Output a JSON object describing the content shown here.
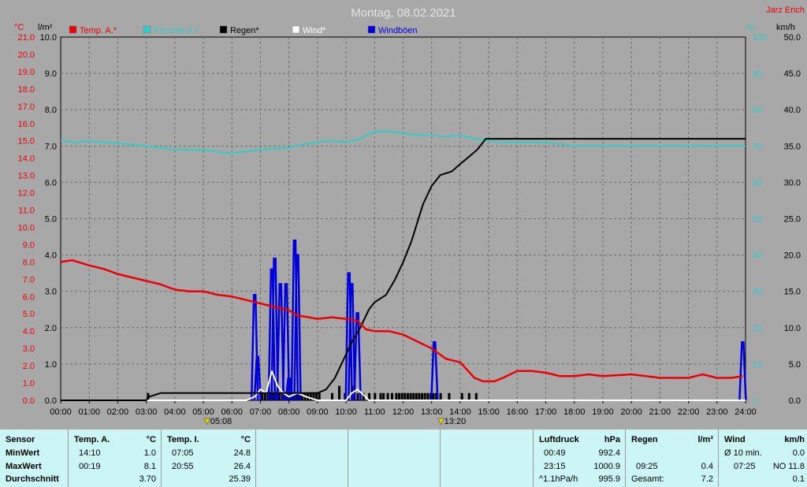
{
  "chart_data": {
    "type": "line",
    "title": "Montag, 08.02.2021",
    "station": "Jarz Erich",
    "colors": {
      "temp": "#ee0000",
      "humidity": "#33cccc",
      "rain": "#000000",
      "wind": "#ffffff",
      "gust": "#0000dd"
    },
    "legend": [
      {
        "label": "Temp. A.*",
        "color": "#ee0000"
      },
      {
        "label": "Feuchte A.*",
        "color": "#33cccc"
      },
      {
        "label": "Regen*",
        "color": "#000000"
      },
      {
        "label": "Wind*",
        "color": "#ffffff"
      },
      {
        "label": "Windböen",
        "color": "#0000dd"
      }
    ],
    "axes": {
      "temp": {
        "unit": "°C",
        "min": 0,
        "max": 21,
        "ticks": [
          "0.0",
          "1.0",
          "2.0",
          "3.0",
          "4.0",
          "5.0",
          "6.0",
          "7.0",
          "8.0",
          "9.0",
          "10.0",
          "11.0",
          "12.0",
          "13.0",
          "14.0",
          "15.0",
          "16.0",
          "17.0",
          "18.0",
          "19.0",
          "20.0",
          "21.0"
        ]
      },
      "rain": {
        "unit": "l/m²",
        "min": 0,
        "max": 10,
        "ticks": [
          "0.0",
          "1.0",
          "2.0",
          "3.0",
          "4.0",
          "5.0",
          "6.0",
          "7.0",
          "8.0",
          "9.0",
          "10.0"
        ]
      },
      "humidity": {
        "unit": "%",
        "min": 0,
        "max": 100,
        "ticks": [
          "0",
          "10",
          "20",
          "30",
          "40",
          "50",
          "60",
          "70",
          "80",
          "90",
          "100"
        ]
      },
      "wind": {
        "unit": "km/h",
        "min": 0,
        "max": 50,
        "ticks": [
          "0.0",
          "5.0",
          "10.0",
          "15.0",
          "20.0",
          "25.0",
          "30.0",
          "35.0",
          "40.0",
          "45.0",
          "50.0"
        ]
      },
      "x": {
        "min": 0,
        "max": 24,
        "ticks": [
          "00:00",
          "01:00",
          "02:00",
          "03:00",
          "04:00",
          "05:00",
          "06:00",
          "07:00",
          "08:00",
          "09:00",
          "10:00",
          "11:00",
          "12:00",
          "13:00",
          "14:00",
          "15:00",
          "16:00",
          "17:00",
          "18:00",
          "19:00",
          "20:00",
          "21:00",
          "22:00",
          "23:00",
          "24:00"
        ]
      }
    },
    "grid": true,
    "sun_markers": [
      {
        "hour": 5.13,
        "label": "05:08"
      },
      {
        "hour": 13.33,
        "label": "13:20"
      }
    ],
    "series": [
      {
        "name": "Temp. A.*",
        "axis": "temp",
        "points": [
          [
            0,
            8.0
          ],
          [
            0.4,
            8.1
          ],
          [
            1,
            7.8
          ],
          [
            1.5,
            7.6
          ],
          [
            2,
            7.3
          ],
          [
            2.5,
            7.1
          ],
          [
            3,
            6.9
          ],
          [
            3.5,
            6.7
          ],
          [
            4,
            6.4
          ],
          [
            4.5,
            6.3
          ],
          [
            5,
            6.3
          ],
          [
            5.5,
            6.1
          ],
          [
            6,
            6.0
          ],
          [
            6.5,
            5.8
          ],
          [
            7,
            5.6
          ],
          [
            7.5,
            5.4
          ],
          [
            8,
            5.2
          ],
          [
            8.3,
            4.9
          ],
          [
            8.7,
            4.8
          ],
          [
            9,
            4.7
          ],
          [
            9.5,
            4.8
          ],
          [
            10,
            4.7
          ],
          [
            10.4,
            4.6
          ],
          [
            10.7,
            4.1
          ],
          [
            11,
            4.0
          ],
          [
            11.5,
            4.0
          ],
          [
            12,
            3.8
          ],
          [
            12.5,
            3.4
          ],
          [
            13,
            3.0
          ],
          [
            13.5,
            2.4
          ],
          [
            14,
            2.2
          ],
          [
            14.5,
            1.3
          ],
          [
            14.8,
            1.1
          ],
          [
            15.2,
            1.1
          ],
          [
            15.5,
            1.3
          ],
          [
            16,
            1.7
          ],
          [
            16.5,
            1.7
          ],
          [
            17,
            1.6
          ],
          [
            17.5,
            1.4
          ],
          [
            18,
            1.4
          ],
          [
            18.5,
            1.5
          ],
          [
            19,
            1.4
          ],
          [
            20,
            1.5
          ],
          [
            20.5,
            1.4
          ],
          [
            21,
            1.3
          ],
          [
            22,
            1.3
          ],
          [
            22.5,
            1.5
          ],
          [
            23,
            1.3
          ],
          [
            23.5,
            1.3
          ],
          [
            23.9,
            1.4
          ]
        ]
      },
      {
        "name": "Feuchte A.*",
        "axis": "humidity",
        "points": [
          [
            0,
            71.5
          ],
          [
            0.5,
            71
          ],
          [
            1,
            71.3
          ],
          [
            2,
            70.8
          ],
          [
            3,
            70
          ],
          [
            4,
            69
          ],
          [
            5,
            69
          ],
          [
            5.8,
            68
          ],
          [
            6.5,
            68.5
          ],
          [
            7,
            69
          ],
          [
            8,
            69.5
          ],
          [
            8.5,
            70.5
          ],
          [
            9,
            71
          ],
          [
            9.5,
            71.5
          ],
          [
            10,
            71
          ],
          [
            10.5,
            72
          ],
          [
            11,
            74
          ],
          [
            11.5,
            74
          ],
          [
            12,
            73.5
          ],
          [
            12.5,
            73
          ],
          [
            13,
            73
          ],
          [
            13.5,
            72.5
          ],
          [
            14,
            73
          ],
          [
            14.5,
            72
          ],
          [
            15,
            71.5
          ],
          [
            15.5,
            71
          ],
          [
            16,
            71
          ],
          [
            17,
            71
          ],
          [
            17.5,
            70.5
          ],
          [
            18,
            70
          ],
          [
            19,
            70
          ],
          [
            20,
            70
          ],
          [
            21,
            70
          ],
          [
            22,
            70
          ],
          [
            23,
            70
          ],
          [
            24,
            70
          ]
        ]
      },
      {
        "name": "Regen*",
        "axis": "rain",
        "points": [
          [
            0,
            0
          ],
          [
            3,
            0
          ],
          [
            3.1,
            0.1
          ],
          [
            3.5,
            0.2
          ],
          [
            4,
            0.2
          ],
          [
            9,
            0.2
          ],
          [
            9.3,
            0.3
          ],
          [
            9.6,
            0.6
          ],
          [
            9.9,
            1.1
          ],
          [
            10.2,
            1.6
          ],
          [
            10.5,
            2.0
          ],
          [
            10.8,
            2.5
          ],
          [
            11,
            2.7
          ],
          [
            11.4,
            2.9
          ],
          [
            11.7,
            3.3
          ],
          [
            12,
            3.8
          ],
          [
            12.3,
            4.4
          ],
          [
            12.5,
            4.9
          ],
          [
            12.7,
            5.4
          ],
          [
            13,
            5.9
          ],
          [
            13.3,
            6.2
          ],
          [
            13.7,
            6.3
          ],
          [
            14,
            6.5
          ],
          [
            14.3,
            6.7
          ],
          [
            14.6,
            6.9
          ],
          [
            14.9,
            7.2
          ],
          [
            15.2,
            7.2
          ],
          [
            24,
            7.2
          ]
        ]
      },
      {
        "name": "Wind*",
        "axis": "wind",
        "points": [
          [
            0,
            0
          ],
          [
            6.5,
            0
          ],
          [
            6.8,
            0.5
          ],
          [
            7.0,
            1.5
          ],
          [
            7.2,
            1.0
          ],
          [
            7.4,
            4.0
          ],
          [
            7.6,
            2.0
          ],
          [
            7.8,
            1.0
          ],
          [
            8.0,
            0.5
          ],
          [
            8.3,
            1.0
          ],
          [
            8.6,
            0.5
          ],
          [
            9,
            0
          ],
          [
            10,
            0
          ],
          [
            10.2,
            1.0
          ],
          [
            10.4,
            1.5
          ],
          [
            10.6,
            0.8
          ],
          [
            10.8,
            0
          ],
          [
            24,
            0
          ]
        ]
      },
      {
        "name": "Windböen",
        "axis": "wind",
        "spikes": [
          [
            6.8,
            14.5
          ],
          [
            6.9,
            6
          ],
          [
            7.4,
            18
          ],
          [
            7.5,
            19.5
          ],
          [
            7.7,
            16
          ],
          [
            7.9,
            16
          ],
          [
            8.0,
            3
          ],
          [
            8.2,
            22
          ],
          [
            8.3,
            20
          ],
          [
            10.1,
            17.5
          ],
          [
            10.2,
            16
          ],
          [
            10.4,
            12
          ],
          [
            13.1,
            8
          ],
          [
            23.9,
            8
          ]
        ]
      }
    ],
    "rain_bars": [
      3.05,
      7.05,
      7.15,
      7.25,
      7.35,
      7.45,
      7.55,
      7.65,
      7.75,
      7.85,
      7.95,
      8.05,
      8.15,
      8.25,
      8.35,
      8.45,
      8.55,
      8.65,
      8.75,
      8.85,
      8.95,
      9.05,
      9.5,
      9.75,
      9.95,
      10.2,
      10.4,
      10.6,
      10.8,
      11.0,
      11.2,
      11.3,
      11.45,
      11.6,
      11.75,
      11.85,
      11.95,
      12.05,
      12.15,
      12.25,
      12.35,
      12.45,
      12.55,
      12.65,
      12.75,
      12.85,
      12.95,
      13.05,
      13.15,
      13.3,
      13.6,
      14.05,
      14.3,
      14.55
    ],
    "rain_bar_tall": [
      9.75,
      10.2
    ]
  },
  "stats": {
    "sensor_label": "Sensor",
    "rows": [
      "MinWert",
      "MaxWert",
      "Durchschnitt"
    ],
    "temp_a": {
      "title": "Temp. A.",
      "unit": "°C",
      "min_time": "14:10",
      "min": "1.0",
      "max_time": "00:19",
      "max": "8.1",
      "avg": "3.70"
    },
    "temp_i": {
      "title": "Temp. I.",
      "unit": "°C",
      "min_time": "07:05",
      "min": "24.8",
      "max_time": "20:55",
      "max": "26.4",
      "avg": "25.39"
    },
    "pressure": {
      "title": "Luftdruck",
      "unit": "hPa",
      "min_time": "00:49",
      "min": "992.4",
      "max_time": "23:15",
      "max": "1000.9",
      "trend": "^1.1hPa/h",
      "avg": "995.9"
    },
    "rain": {
      "title": "Regen",
      "unit": "l/m²",
      "max_time": "09:25",
      "max": "0.4",
      "total_label": "Gesamt:",
      "total": "7.2"
    },
    "wind": {
      "title": "Wind",
      "unit": "km/h",
      "avg_label": "Ø 10 min.",
      "avg": "0.0",
      "max_time": "07:25",
      "max": "NO 11.8",
      "day_avg": "0.1"
    }
  }
}
